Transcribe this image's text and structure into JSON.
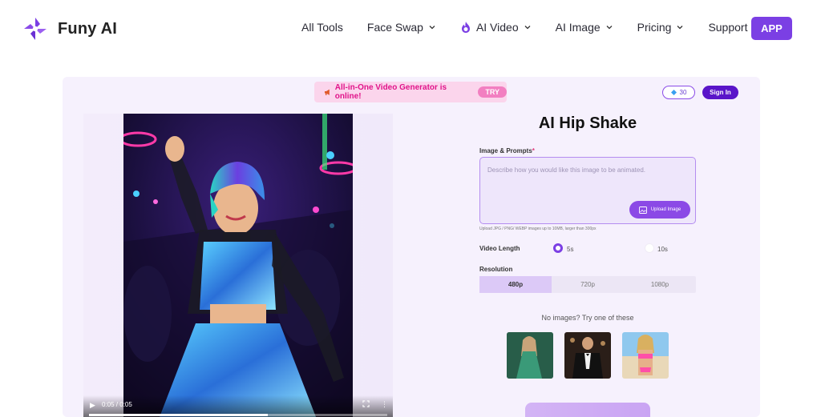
{
  "header": {
    "brand": "Funy AI",
    "nav": [
      {
        "label": "All Tools",
        "has_dropdown": false,
        "icon": ""
      },
      {
        "label": "Face Swap",
        "has_dropdown": true,
        "icon": ""
      },
      {
        "label": "AI Video",
        "has_dropdown": true,
        "icon": "flame-icon"
      },
      {
        "label": "AI Image",
        "has_dropdown": true,
        "icon": ""
      },
      {
        "label": "Pricing",
        "has_dropdown": true,
        "icon": ""
      },
      {
        "label": "Support",
        "has_dropdown": true,
        "icon": ""
      }
    ],
    "app_button": "APP"
  },
  "promo": {
    "icon": "megaphone-icon",
    "text": "All-in-One Video Generator is online!",
    "try_label": "TRY"
  },
  "account": {
    "credits": "30",
    "sign_in": "Sign In"
  },
  "video": {
    "time": "0:05 / 0:05",
    "progress": 0.6
  },
  "form": {
    "title": "AI Hip Shake",
    "prompt_label": "Image & Prompts",
    "prompt_required": "*",
    "prompt_placeholder": "Describe how you would like this image to be animated.",
    "upload_label": "Upload Image",
    "upload_hint": "Upload JPG / PNG/ WEBP images up to 10MB, larger than 300px",
    "length_label": "Video Length",
    "length_options": [
      {
        "label": "5s",
        "selected": true
      },
      {
        "label": "10s",
        "selected": false
      }
    ],
    "resolution_label": "Resolution",
    "resolution_options": [
      {
        "label": "480p",
        "selected": true
      },
      {
        "label": "720p",
        "selected": false
      },
      {
        "label": "1080p",
        "selected": false
      }
    ],
    "samples_title": "No images? Try one of these"
  },
  "colors": {
    "accent": "#7b3fe4",
    "sign_in_bg": "#5a15c9",
    "promo_bg": "#fbd5ec",
    "promo_text": "#e0148a",
    "panel_bg": "#f6f1fd"
  }
}
